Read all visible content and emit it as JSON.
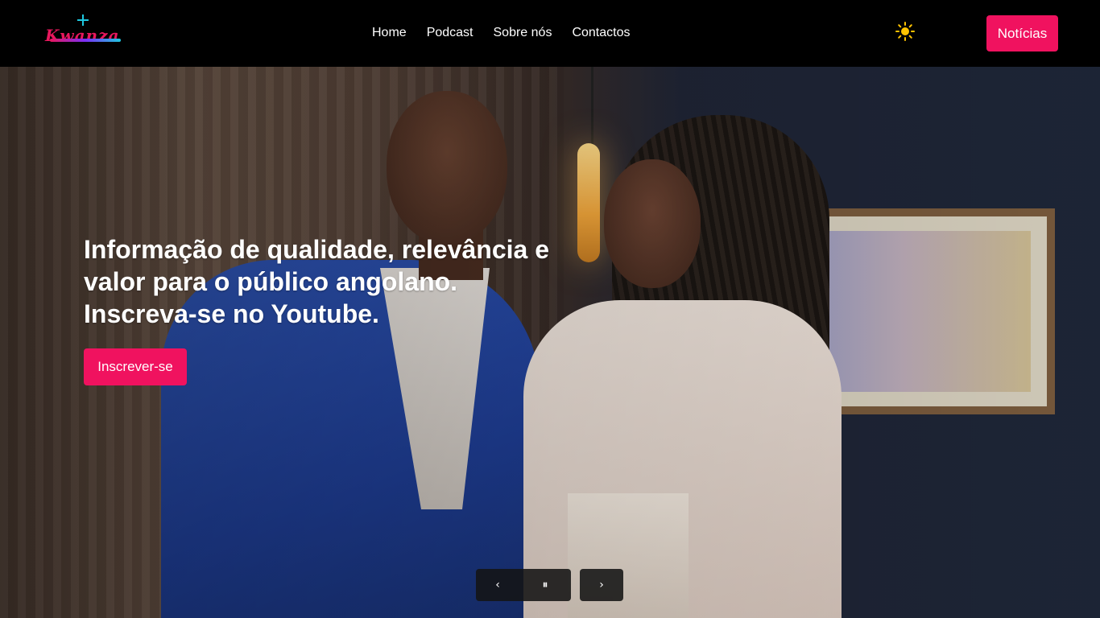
{
  "brand": {
    "logo_text": "Kwanza"
  },
  "nav": {
    "items": [
      {
        "label": "Home"
      },
      {
        "label": "Podcast"
      },
      {
        "label": "Sobre nós"
      },
      {
        "label": "Contactos"
      }
    ]
  },
  "header": {
    "theme_icon": "sun-icon",
    "news_button": "Notícias"
  },
  "hero": {
    "title": "Informação de qualidade, relevância e valor para o público angolano. Inscreva-se no Youtube.",
    "subscribe_button": "Inscrever-se",
    "controls": {
      "prev_icon": "‹",
      "pause_icon": "⏸",
      "next_icon": "›"
    }
  },
  "colors": {
    "accent": "#f0125f",
    "header_bg": "#000000",
    "sun": "#ffc400"
  }
}
